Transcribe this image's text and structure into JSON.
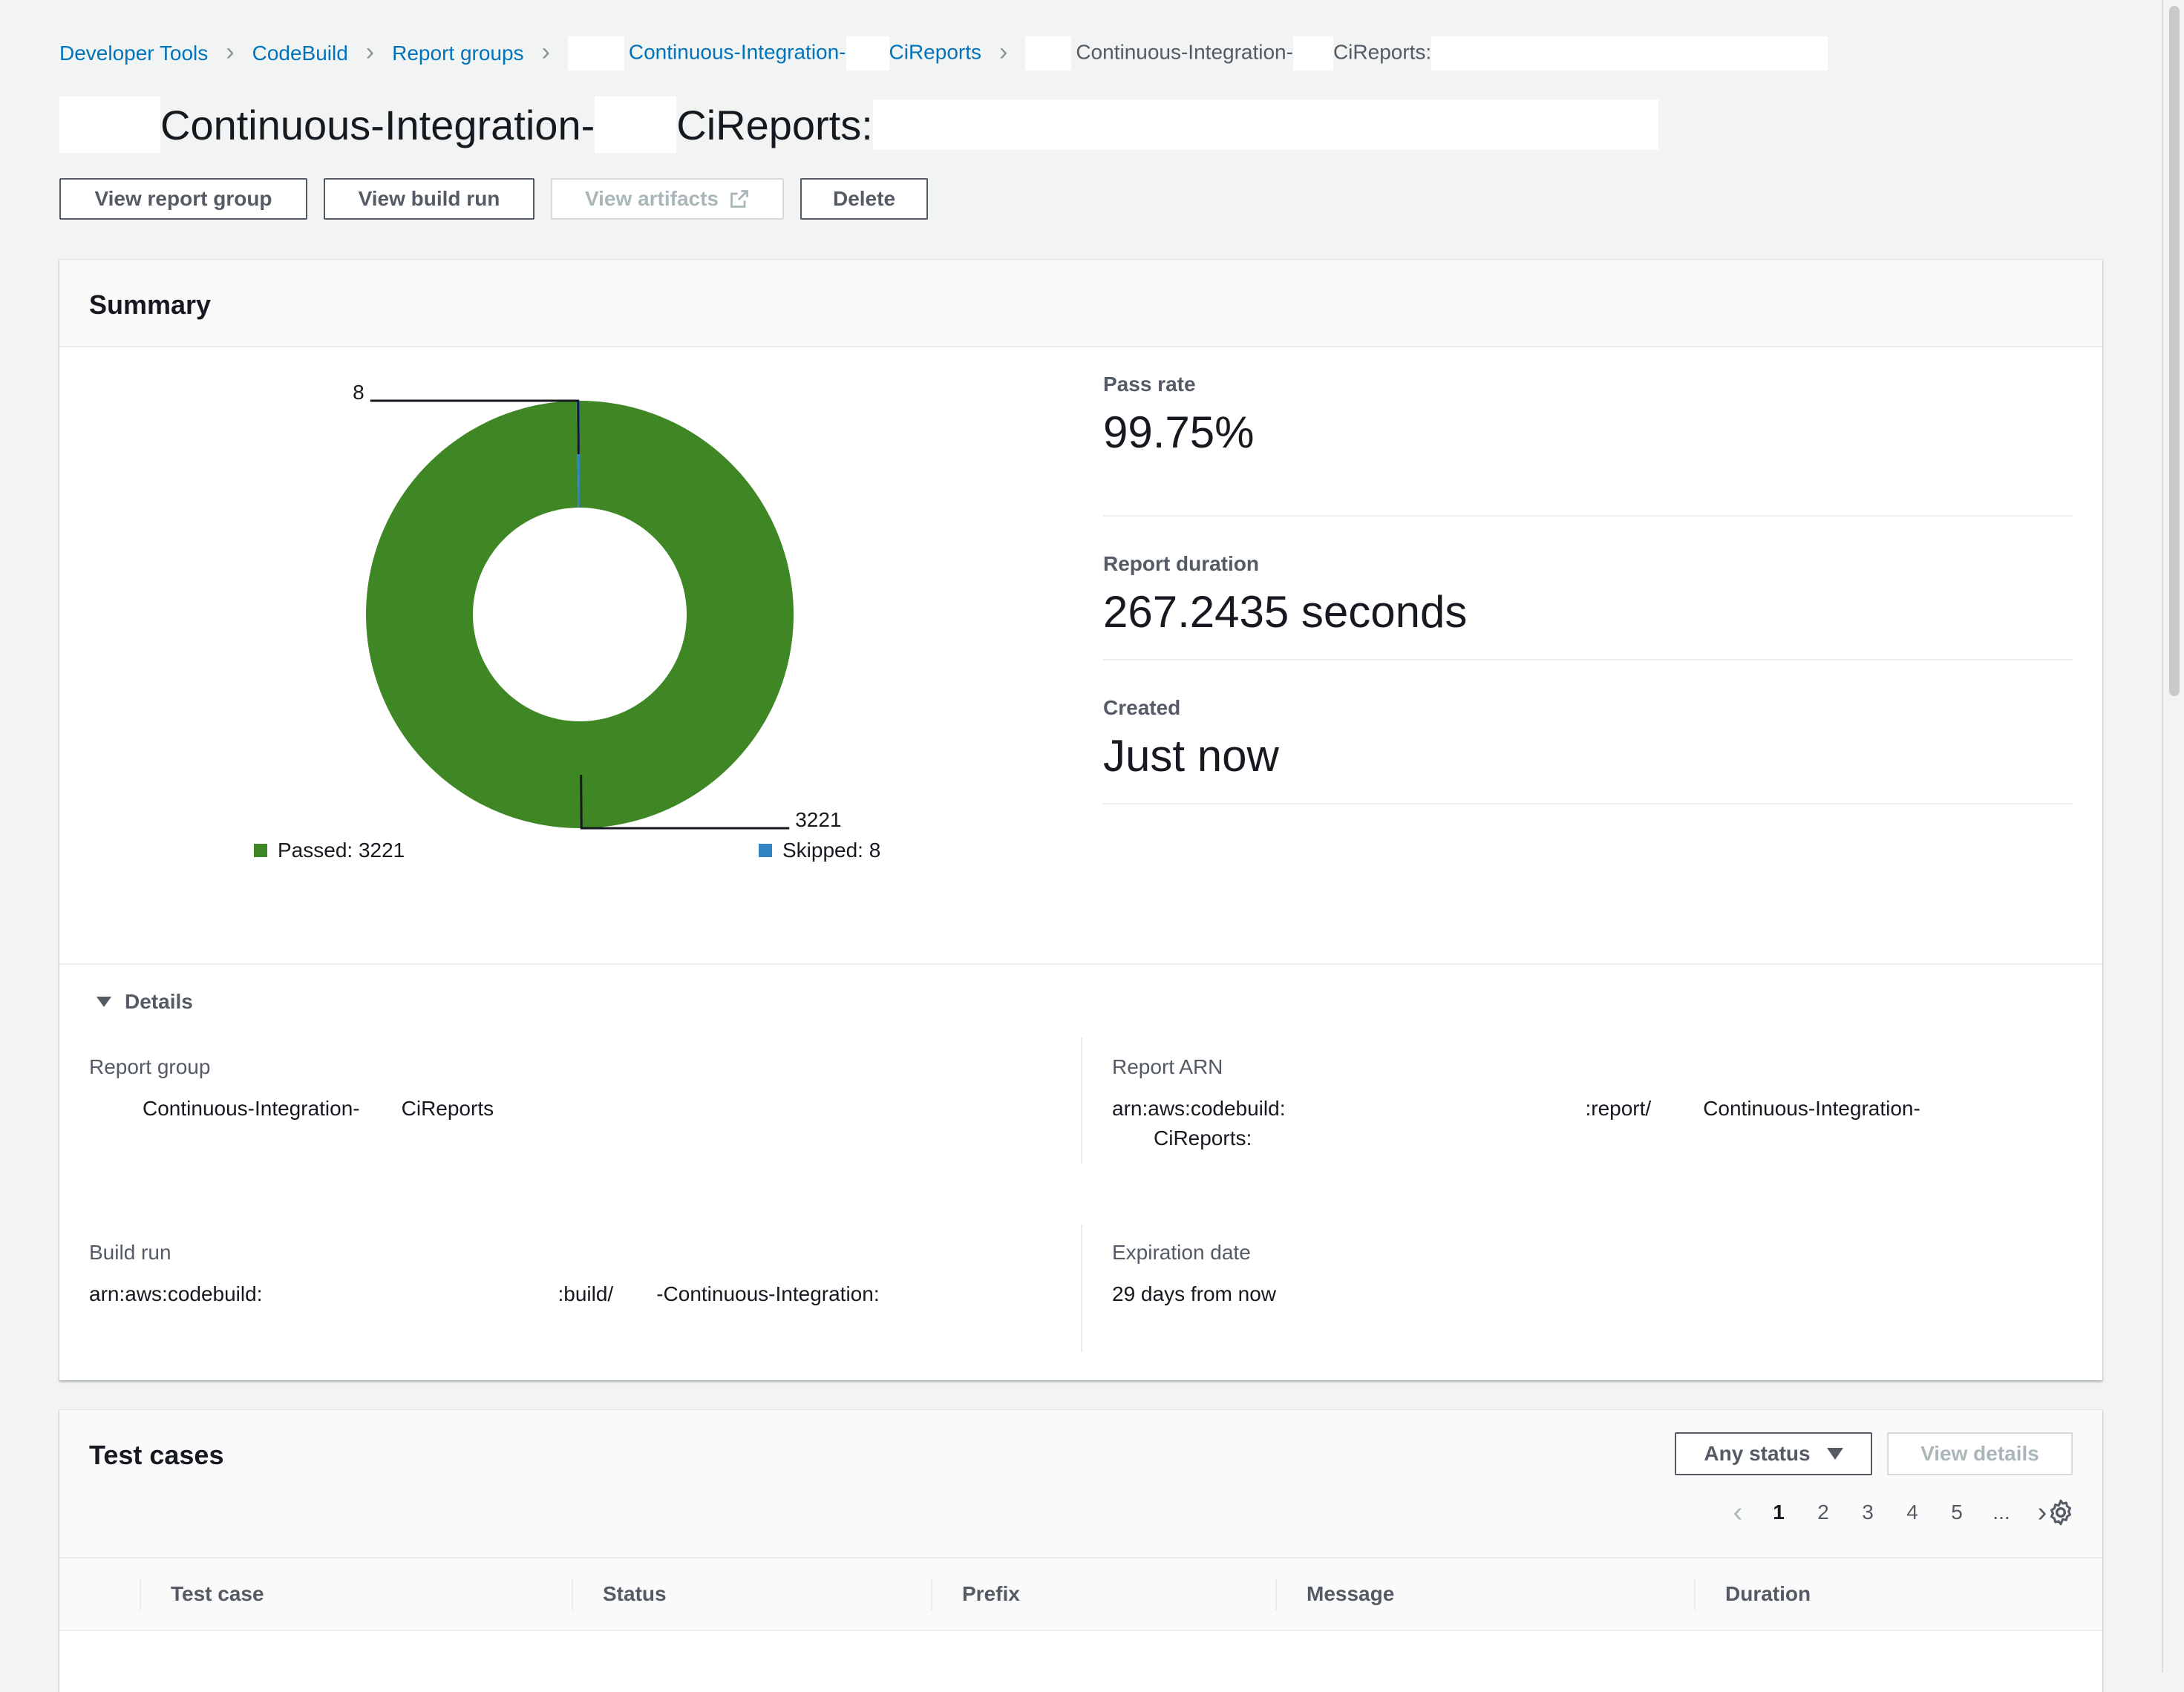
{
  "breadcrumb": {
    "items": [
      "Developer Tools",
      "CodeBuild",
      "Report groups",
      "Continuous-Integration-",
      "CiReports"
    ],
    "current_part1": "Continuous-Integration-",
    "current_part2": "CiReports:"
  },
  "page": {
    "title_part1": "Continuous-Integration-",
    "title_part2": "CiReports:"
  },
  "actions": {
    "view_report_group": "View report group",
    "view_build_run": "View build run",
    "view_artifacts": "View artifacts",
    "delete": "Delete"
  },
  "summary": {
    "title": "Summary",
    "pass_rate_label": "Pass rate",
    "pass_rate_value": "99.75%",
    "duration_label": "Report duration",
    "duration_value": "267.2435 seconds",
    "created_label": "Created",
    "created_value": "Just now",
    "legend_passed": "Passed: 3221",
    "legend_skipped": "Skipped: 8",
    "colors": {
      "passed": "#3f8624",
      "skipped": "#3184c2"
    }
  },
  "chart_data": {
    "type": "pie",
    "categories": [
      "Passed",
      "Skipped"
    ],
    "values": [
      3221,
      8
    ],
    "data_labels": [
      "3221",
      "8"
    ]
  },
  "details": {
    "toggle_label": "Details",
    "report_group_label": "Report group",
    "report_group_value_part1": "Continuous-Integration-",
    "report_group_value_part2": "CiReports",
    "report_arn_label": "Report ARN",
    "report_arn_line1_part1": "arn:aws:codebuild:",
    "report_arn_line1_part2": ":report/",
    "report_arn_line1_part3": "Continuous-Integration-",
    "report_arn_line2": "CiReports:",
    "build_run_label": "Build run",
    "build_run_line1_part1": "arn:aws:codebuild:",
    "build_run_line1_part2": ":build/",
    "build_run_line1_part3": "-Continuous-Integration:",
    "expiration_label": "Expiration date",
    "expiration_value": "29 days from now"
  },
  "test_cases": {
    "title": "Test cases",
    "status_filter": "Any status",
    "view_details": "View details",
    "pages": [
      "1",
      "2",
      "3",
      "4",
      "5",
      "..."
    ],
    "active_page": "1",
    "columns": [
      "Test case",
      "Status",
      "Prefix",
      "Message",
      "Duration"
    ]
  }
}
